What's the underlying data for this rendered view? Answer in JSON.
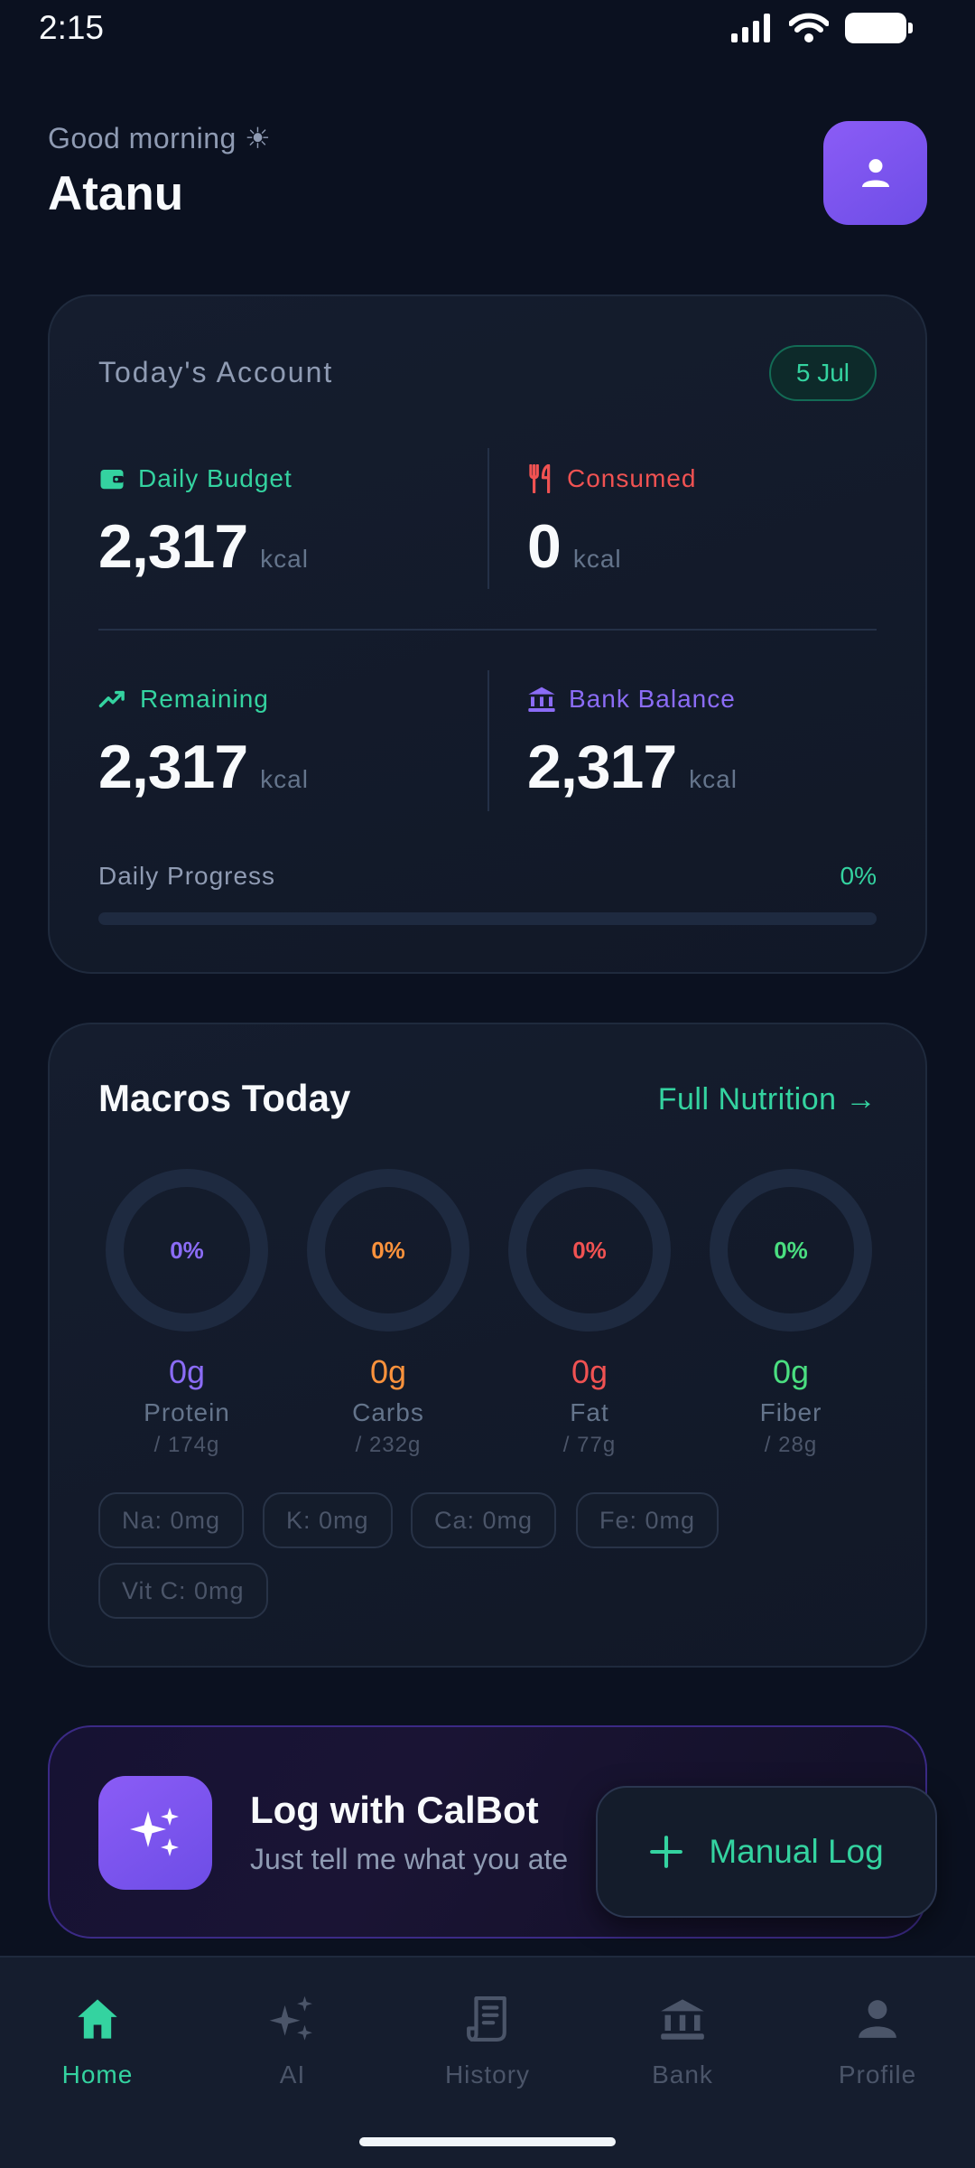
{
  "status_bar": {
    "time": "2:15"
  },
  "header": {
    "greeting": "Good morning ☀",
    "name": "Atanu"
  },
  "account": {
    "title": "Today's Account",
    "date": "5 Jul",
    "daily_budget": {
      "label": "Daily Budget",
      "value": "2,317",
      "unit": "kcal"
    },
    "consumed": {
      "label": "Consumed",
      "value": "0",
      "unit": "kcal"
    },
    "remaining": {
      "label": "Remaining",
      "value": "2,317",
      "unit": "kcal"
    },
    "bank_balance": {
      "label": "Bank Balance",
      "value": "2,317",
      "unit": "kcal"
    },
    "progress_label": "Daily Progress",
    "progress_pct": "0%",
    "progress_fraction": 0
  },
  "macros": {
    "title": "Macros Today",
    "link": "Full Nutrition →",
    "items": [
      {
        "pct": "0%",
        "value": "0g",
        "name": "Protein",
        "goal": "/ 174g",
        "color": "#8b6cf6"
      },
      {
        "pct": "0%",
        "value": "0g",
        "name": "Carbs",
        "goal": "/ 232g",
        "color": "#fb923c"
      },
      {
        "pct": "0%",
        "value": "0g",
        "name": "Fat",
        "goal": "/ 77g",
        "color": "#f05252"
      },
      {
        "pct": "0%",
        "value": "0g",
        "name": "Fiber",
        "goal": "/ 28g",
        "color": "#4ade80"
      }
    ],
    "chips": [
      "Na: 0mg",
      "K: 0mg",
      "Ca: 0mg",
      "Fe: 0mg",
      "Vit C: 0mg"
    ]
  },
  "calbot": {
    "title": "Log with CalBot",
    "subtitle": "Just tell me what you ate"
  },
  "manual_log": {
    "label": "Manual Log"
  },
  "nav": {
    "items": [
      {
        "label": "Home",
        "icon": "home-icon",
        "active": true
      },
      {
        "label": "AI",
        "icon": "sparkles-icon",
        "active": false
      },
      {
        "label": "History",
        "icon": "receipt-icon",
        "active": false
      },
      {
        "label": "Bank",
        "icon": "bank-icon",
        "active": false
      },
      {
        "label": "Profile",
        "icon": "profile-icon",
        "active": false
      }
    ]
  },
  "colors": {
    "accent": "#34d3a0",
    "purple": "#8b5cf6",
    "consumed_red": "#f05252",
    "bank_purple": "#8b6cf6"
  }
}
